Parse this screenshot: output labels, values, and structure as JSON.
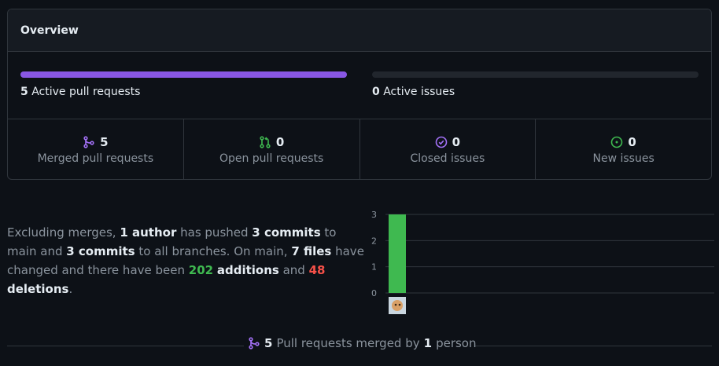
{
  "overview": {
    "title": "Overview",
    "active_prs": {
      "count": "5",
      "label": "Active pull requests",
      "progress": 1.0
    },
    "active_issues": {
      "count": "0",
      "label": "Active issues",
      "progress": 0.0
    },
    "colors": {
      "pr_bar": "#8957e5",
      "merged": "#a371f7",
      "open": "#3fb950",
      "closed": "#a371f7",
      "new": "#3fb950"
    },
    "stats": [
      {
        "value": "5",
        "label": "Merged pull requests",
        "icon": "git-merge-icon"
      },
      {
        "value": "0",
        "label": "Open pull requests",
        "icon": "git-pull-request-icon"
      },
      {
        "value": "0",
        "label": "Closed issues",
        "icon": "issue-closed-icon"
      },
      {
        "value": "0",
        "label": "New issues",
        "icon": "issue-opened-icon"
      }
    ]
  },
  "summary": {
    "p1": "Excluding merges, ",
    "authors": "1 author",
    "p2": " has pushed ",
    "commits_main": "3 commits",
    "p3": " to main and ",
    "commits_all": "3 commits",
    "p4": " to all branches. On main, ",
    "files": "7 files",
    "p5": " have changed and there have been ",
    "additions_num": "202",
    "additions_word": "additions",
    "p6": " and ",
    "deletions_num": "48",
    "deletions_word": "deletions",
    "p7": "."
  },
  "chart_data": {
    "type": "bar",
    "categories": [
      "author-avatar"
    ],
    "values": [
      3
    ],
    "ylim": [
      0,
      3
    ],
    "yticks": [
      "0",
      "1",
      "2",
      "3"
    ],
    "bar_color": "#3fb950",
    "grid": true
  },
  "footer": {
    "count": "5",
    "text": "Pull requests merged by",
    "people": "1",
    "suffix": "person"
  }
}
